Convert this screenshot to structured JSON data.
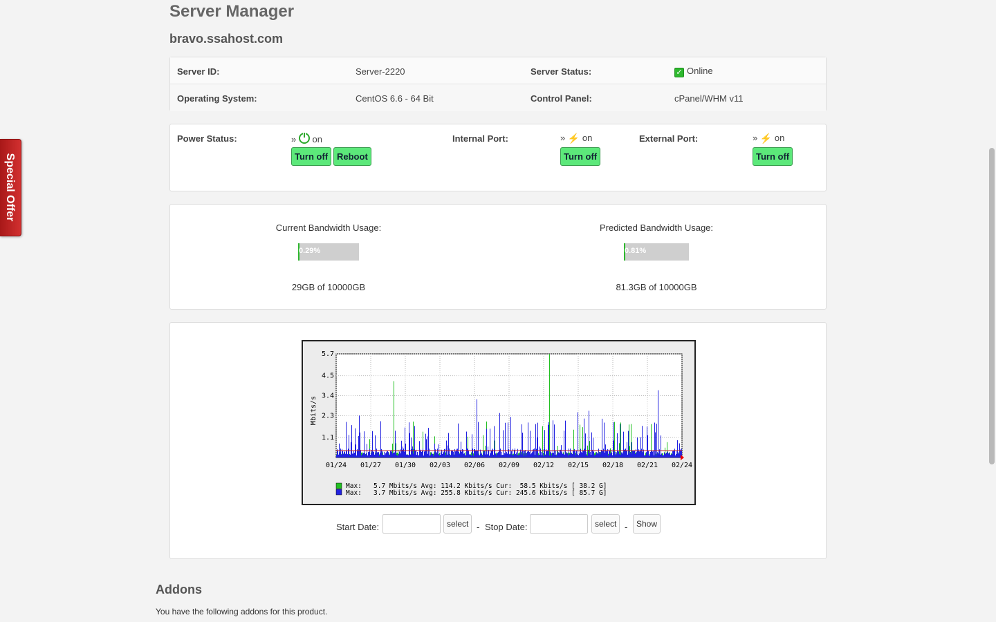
{
  "page": {
    "title": "Server Manager",
    "hostname": "bravo.ssahost.com"
  },
  "special_offer": {
    "label": "Special Offer"
  },
  "server_info": {
    "server_id_label": "Server ID:",
    "server_id": "Server-2220",
    "status_label": "Server Status:",
    "status": "Online",
    "os_label": "Operating System:",
    "os": "CentOS 6.6 - 64 Bit",
    "panel_label": "Control Panel:",
    "panel": "cPanel/WHM v11"
  },
  "power": {
    "power_label": "Power Status:",
    "power_state": "on",
    "power_prefix": "»",
    "turn_off_label": "Turn off",
    "reboot_label": "Reboot",
    "internal_label": "Internal Port:",
    "internal_state": "on",
    "external_label": "External Port:",
    "external_state": "on",
    "status_color": "#5ce87a"
  },
  "bandwidth": {
    "current_label": "Current Bandwidth Usage:",
    "current_percent_text": "0.29%",
    "current_percent": 0.29,
    "current_amount": "29GB of 10000GB",
    "predicted_label": "Predicted Bandwidth Usage:",
    "predicted_percent_text": "0.81%",
    "predicted_percent": 0.81,
    "predicted_amount": "81.3GB of 10000GB"
  },
  "chart_data": {
    "type": "line",
    "ylabel": "Mbits/s",
    "yticks": [
      "5.7",
      "4.5",
      "3.4",
      "2.3",
      "1.1"
    ],
    "xticks": [
      "01/24",
      "01/27",
      "01/30",
      "02/03",
      "02/06",
      "02/09",
      "02/12",
      "02/15",
      "02/18",
      "02/21",
      "02/24"
    ],
    "ylim": [
      0,
      5.7
    ],
    "series": [
      {
        "color": "#22c022",
        "max": 5.7,
        "avg": 114.2,
        "cur": 58.5
      },
      {
        "color": "#2222e0",
        "max": 3.7,
        "avg": 255.8,
        "cur": 245.6
      }
    ],
    "legend": [
      "Max:   5.7 Mbits/s Avg: 114.2 Kbits/s Cur:  58.5 Kbits/s [ 38.2 G]",
      "Max:   3.7 Mbits/s Avg: 255.8 Kbits/s Cur: 245.6 Kbits/s [ 85.7 G]"
    ]
  },
  "dates": {
    "start_label": "Start Date:",
    "stop_label": "Stop Date:",
    "select_label": "select",
    "show_label": "Show",
    "sep": "-"
  },
  "addons": {
    "title": "Addons",
    "text": "You have the following addons for this product."
  }
}
